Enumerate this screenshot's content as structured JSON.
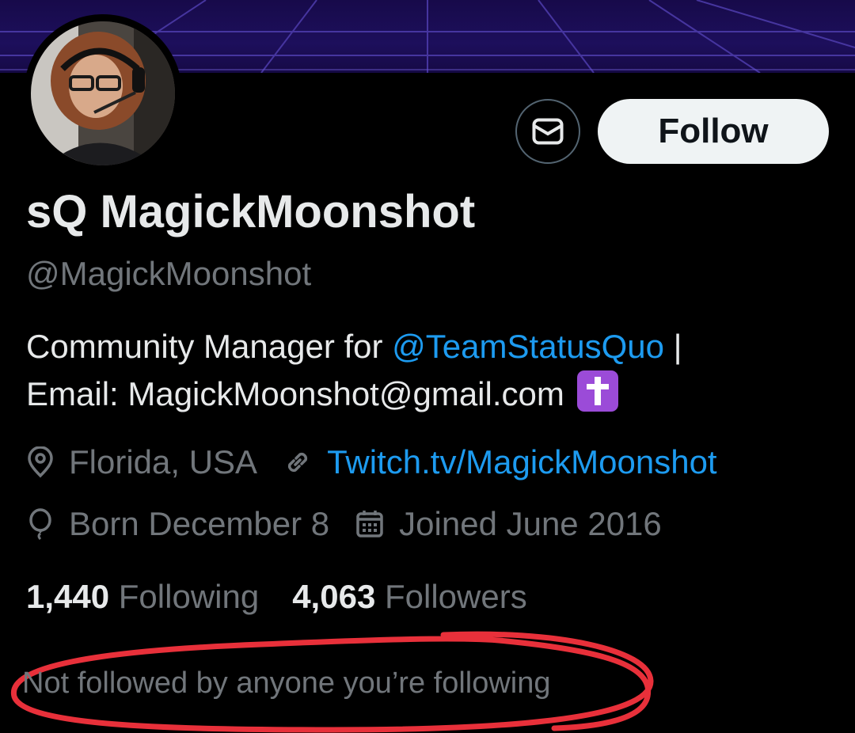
{
  "colors": {
    "background": "#000000",
    "primary_text": "#e7e9ea",
    "secondary_text": "#71767b",
    "link": "#1d9bf0",
    "follow_button_bg": "#eff3f4",
    "annotation": "#e8303a"
  },
  "header": {
    "message_button_icon": "envelope-icon",
    "follow_label": "Follow"
  },
  "profile": {
    "display_name": "sQ MagickMoonshot",
    "handle": "@MagickMoonshot",
    "bio": {
      "prefix": "Community Manager for ",
      "mention": "@TeamStatusQuo",
      "suffix": " |",
      "email_line": "Email: MagickMoonshot@gmail.com",
      "emoji": "latin-cross-emoji"
    },
    "location": "Florida, USA",
    "website": "Twitch.tv/MagickMoonshot",
    "birthday": "Born December 8",
    "joined": "Joined June 2016"
  },
  "stats": {
    "following_count": "1,440",
    "following_label": "Following",
    "followers_count": "4,063",
    "followers_label": "Followers"
  },
  "followed_by_note": "Not followed by anyone you’re following"
}
